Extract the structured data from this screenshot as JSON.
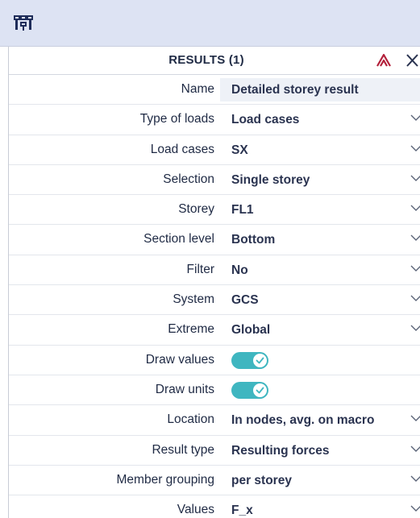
{
  "panel": {
    "title": "RESULTS (1)"
  },
  "icons": {
    "toolbar": "structure-icon",
    "pin": "collapse-up-icon",
    "close": "close-icon",
    "dropdown": "chevron-down-icon",
    "toggle_check": "check-icon"
  },
  "colors": {
    "toolbar_bg": "#dde3f3",
    "toggle_on": "#3fb6c0",
    "pin_red": "#b3203a"
  },
  "properties": [
    {
      "label": "Name",
      "value": "Detailed storey result",
      "kind": "text"
    },
    {
      "label": "Type of loads",
      "value": "Load cases",
      "kind": "select"
    },
    {
      "label": "Load cases",
      "value": "SX",
      "kind": "select"
    },
    {
      "label": "Selection",
      "value": "Single storey",
      "kind": "select"
    },
    {
      "label": "Storey",
      "value": "FL1",
      "kind": "select"
    },
    {
      "label": "Section level",
      "value": "Bottom",
      "kind": "select"
    },
    {
      "label": "Filter",
      "value": "No",
      "kind": "select"
    },
    {
      "label": "System",
      "value": "GCS",
      "kind": "select"
    },
    {
      "label": "Extreme",
      "value": "Global",
      "kind": "select"
    },
    {
      "label": "Draw values",
      "value": "on",
      "kind": "toggle"
    },
    {
      "label": "Draw units",
      "value": "on",
      "kind": "toggle"
    },
    {
      "label": "Location",
      "value": "In nodes, avg. on macro",
      "kind": "select"
    },
    {
      "label": "Result type",
      "value": "Resulting forces",
      "kind": "select"
    },
    {
      "label": "Member grouping",
      "value": "per storey",
      "kind": "select"
    },
    {
      "label": "Values",
      "value": "F_x",
      "kind": "select"
    }
  ]
}
